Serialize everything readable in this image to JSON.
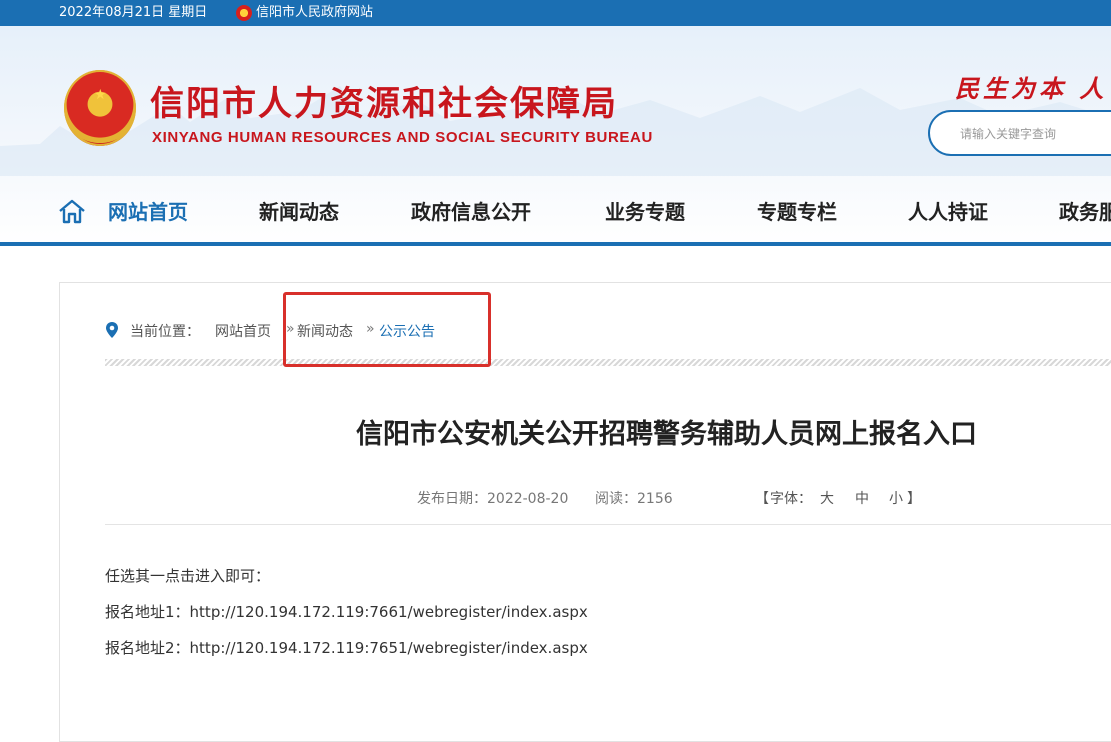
{
  "topbar": {
    "date": "2022年08月21日 星期日",
    "gov_link": "信阳市人民政府网站"
  },
  "header": {
    "title_cn": "信阳市人力资源和社会保障局",
    "title_en": "XINYANG HUMAN RESOURCES AND SOCIAL SECURITY BUREAU",
    "slogan": "民生为本 人",
    "search_placeholder": "请输入关键字查询"
  },
  "nav": {
    "items": [
      {
        "label": "网站首页",
        "active": true
      },
      {
        "label": "新闻动态"
      },
      {
        "label": "政府信息公开"
      },
      {
        "label": "业务专题"
      },
      {
        "label": "专题专栏"
      },
      {
        "label": "人人持证"
      },
      {
        "label": "政务服"
      }
    ]
  },
  "breadcrumb": {
    "label": "当前位置：",
    "items": [
      "网站首页",
      "新闻动态",
      "公示公告"
    ],
    "separator": "»"
  },
  "article": {
    "title": "信阳市公安机关公开招聘警务辅助人员网上报名入口",
    "publish_date": "发布日期：2022-08-20",
    "reads": "阅读：2156",
    "font_size": {
      "open": "【",
      "label": "字体：",
      "large": "大",
      "medium": "中",
      "small": "小",
      "close": "】"
    },
    "paragraphs": [
      "任选其一点击进入即可：",
      "报名地址1：http://120.194.172.119:7661/webregister/index.aspx",
      "报名地址2：http://120.194.172.119:7651/webregister/index.aspx"
    ]
  },
  "colors": {
    "brand_blue": "#1b6fb3",
    "title_red": "#c8161d",
    "highlight_red": "#d8302b"
  },
  "icons": [
    "national-emblem-icon",
    "home-icon",
    "location-pin-icon"
  ]
}
